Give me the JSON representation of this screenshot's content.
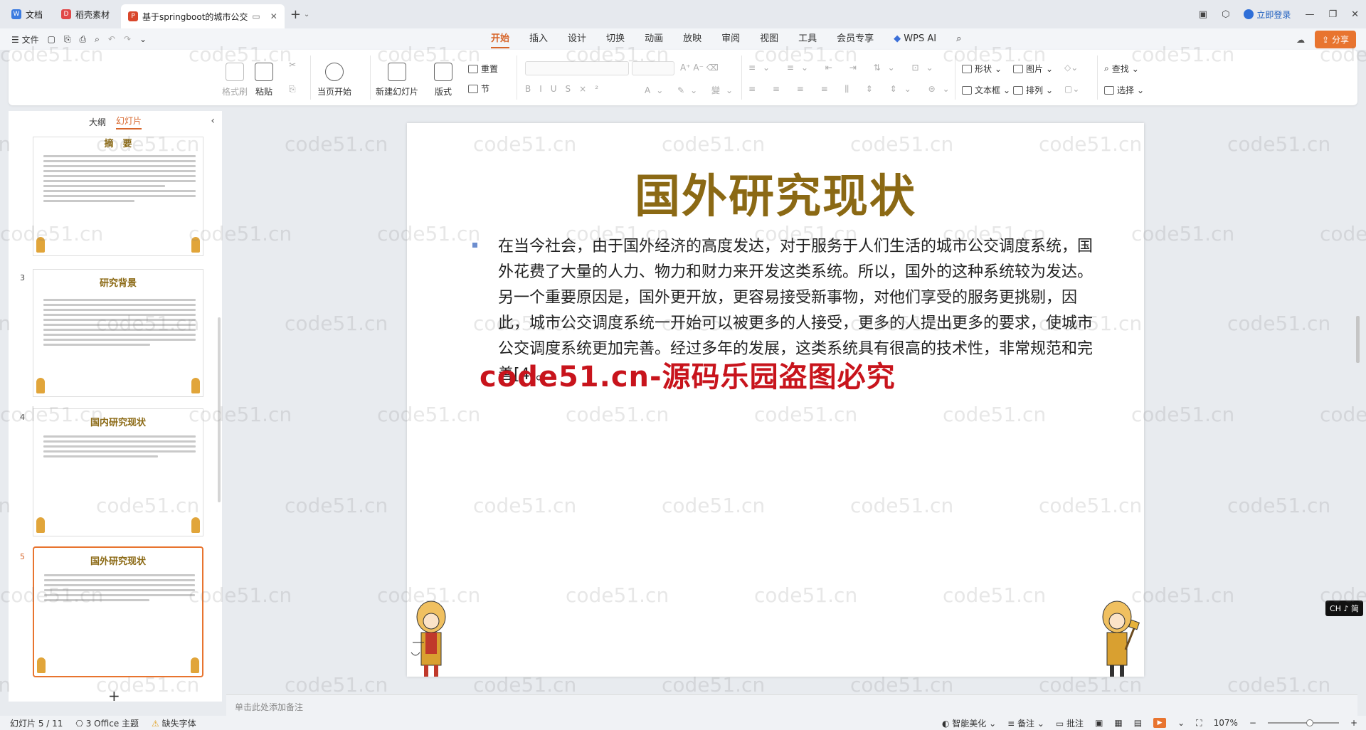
{
  "tabs": [
    {
      "label": "文档",
      "icon": "doc-icon",
      "active": false
    },
    {
      "label": "稻壳素材",
      "icon": "docer-icon",
      "active": false
    },
    {
      "label": "基于springboot的城市公交",
      "icon": "ppt-icon",
      "active": true
    }
  ],
  "window": {
    "login": "立即登录"
  },
  "menubar": {
    "file": "文件",
    "tabs": [
      "开始",
      "插入",
      "设计",
      "切换",
      "动画",
      "放映",
      "审阅",
      "视图",
      "工具",
      "会员专享"
    ],
    "wps_ai": "WPS AI",
    "share": "分享"
  },
  "ribbon": {
    "format_painter": "格式刷",
    "paste": "粘贴",
    "play_current": "当页开始",
    "new_slide": "新建幻灯片",
    "layout": "版式",
    "reset": "重置",
    "section": "节",
    "shape": "形状",
    "picture": "图片",
    "textbox": "文本框",
    "arrange": "排列",
    "find": "查找",
    "select": "选择"
  },
  "left_panel": {
    "tab_outline": "大纲",
    "tab_slides": "幻灯片",
    "thumbs": [
      {
        "num": "",
        "title": "摘　要",
        "selected": false
      },
      {
        "num": "3",
        "title": "研究背景",
        "selected": false
      },
      {
        "num": "4",
        "title": "国内研究现状",
        "selected": false
      },
      {
        "num": "5",
        "title": "国外研究现状",
        "selected": true
      }
    ]
  },
  "slide": {
    "title": "国外研究现状",
    "body": "在当今社会，由于国外经济的高度发达，对于服务于人们生活的城市公交调度系统，国外花费了大量的人力、物力和财力来开发这类系统。所以，国外的这种系统较为发达。另一个重要原因是，国外更开放，更容易接受新事物，对他们享受的服务更挑剔，因此，城市公交调度系统一开始可以被更多的人接受，更多的人提出更多的要求，使城市公交调度系统更加完善。经过多年的发展，这类系统具有很高的技术性，非常规范和完善[4]。",
    "red_watermark": "code51.cn-源码乐园盗图必究"
  },
  "notes_placeholder": "单击此处添加备注",
  "status": {
    "slide_counter": "幻灯片 5 / 11",
    "theme": "3 Office 主题",
    "missing_font": "缺失字体",
    "beautify": "智能美化",
    "notes": "备注",
    "comments": "批注",
    "zoom": "107%"
  },
  "ime": "CH ♪ 简",
  "watermark": "code51.cn"
}
